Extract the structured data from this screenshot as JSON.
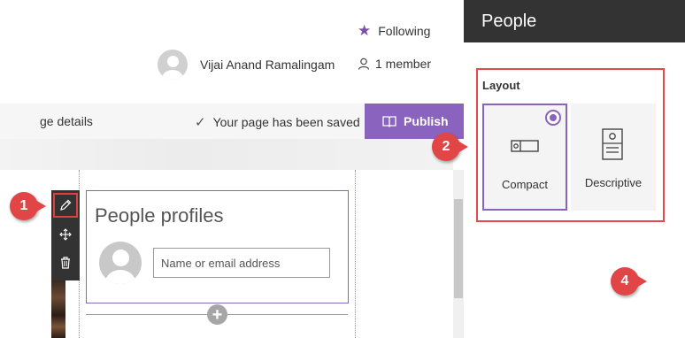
{
  "header": {
    "following_label": "Following",
    "user_name": "Vijai Anand Ramalingam",
    "member_count": "1 member"
  },
  "commandbar": {
    "page_details": "ge details",
    "saved_status": "Your page has been saved",
    "publish_label": "Publish"
  },
  "webpart": {
    "title": "People profiles",
    "input_placeholder": "Name or email address"
  },
  "panel": {
    "title": "People",
    "layout_label": "Layout",
    "options": [
      {
        "label": "Compact",
        "selected": true
      },
      {
        "label": "Descriptive",
        "selected": false
      }
    ]
  },
  "callouts": [
    "1",
    "2",
    "4"
  ],
  "colors": {
    "accent": "#8a63bf",
    "panel_header": "#333333",
    "callout": "#e24545",
    "highlight_border": "#e04a4a"
  },
  "icons": {
    "following": "star-icon",
    "member": "person-icon",
    "saved": "check-icon",
    "publish": "book-icon",
    "edit": "pencil-icon",
    "move": "move-icon",
    "delete": "trash-icon",
    "add": "plus-icon"
  }
}
